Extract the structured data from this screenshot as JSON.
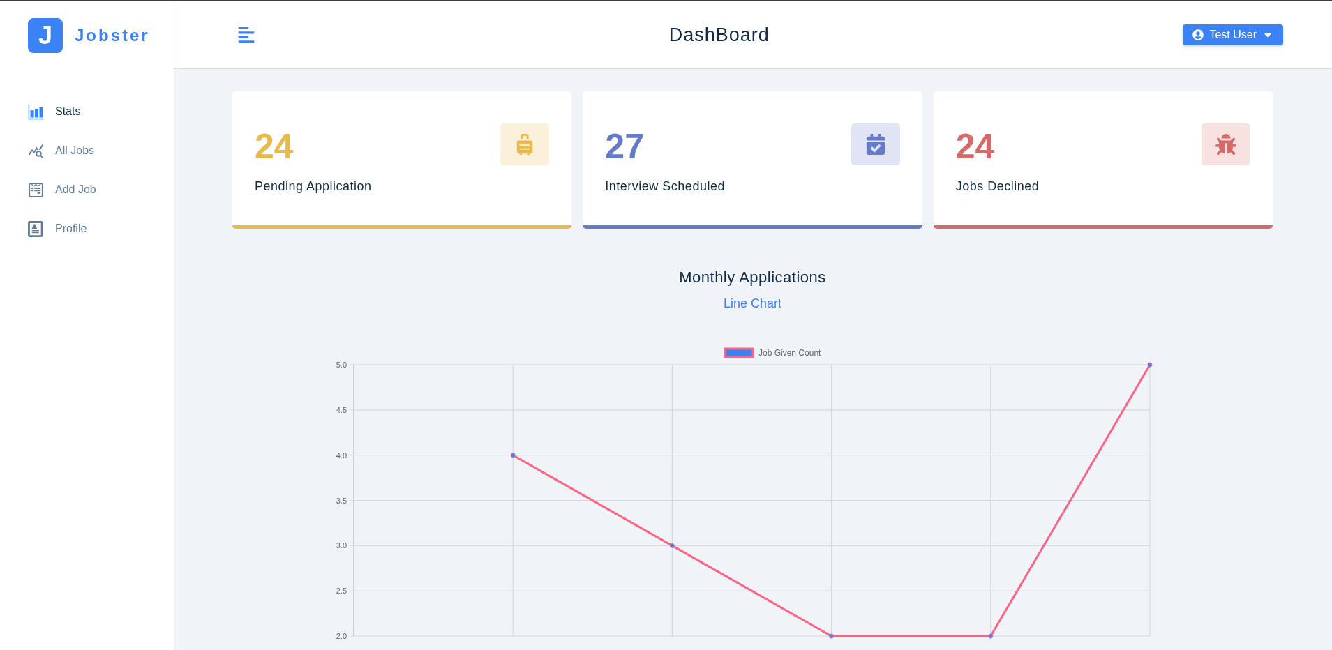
{
  "brand": {
    "logo_letter": "J",
    "name": "Jobster"
  },
  "header": {
    "title": "DashBoard",
    "user_button": "Test User"
  },
  "sidebar": {
    "items": [
      {
        "kind": "stats",
        "label": "Stats",
        "selected": true
      },
      {
        "kind": "all-jobs",
        "label": "All Jobs",
        "selected": false
      },
      {
        "kind": "add-job",
        "label": "Add Job",
        "selected": false
      },
      {
        "kind": "profile",
        "label": "Profile",
        "selected": false
      }
    ]
  },
  "stat_cards": [
    {
      "kind": "pending",
      "count": "24",
      "label": "Pending Application",
      "color": "#e9b949"
    },
    {
      "kind": "interview",
      "count": "27",
      "label": "Interview Scheduled",
      "color": "#647acb"
    },
    {
      "kind": "declined",
      "count": "24",
      "label": "Jobs Declined",
      "color": "#d66a6a"
    }
  ],
  "chart_section": {
    "title": "Monthly Applications",
    "toggle": "Line Chart",
    "chart_data": {
      "type": "line",
      "grid": true,
      "series": [
        {
          "name": "Job Given Count",
          "color": "#ff6384",
          "marker": "circle",
          "values": [
            null,
            4,
            3,
            2,
            2,
            5
          ]
        }
      ],
      "ylim": [
        2,
        5
      ],
      "yticks": [
        {
          "value": 2,
          "label": "2.0"
        },
        {
          "value": 2.5,
          "label": "2.5"
        },
        {
          "value": 3,
          "label": "3.0"
        },
        {
          "value": 3.5,
          "label": "3.5"
        },
        {
          "value": 4,
          "label": "4.0"
        },
        {
          "value": 4.5,
          "label": "4.5"
        },
        {
          "value": 5,
          "label": "5.0"
        }
      ]
    }
  }
}
